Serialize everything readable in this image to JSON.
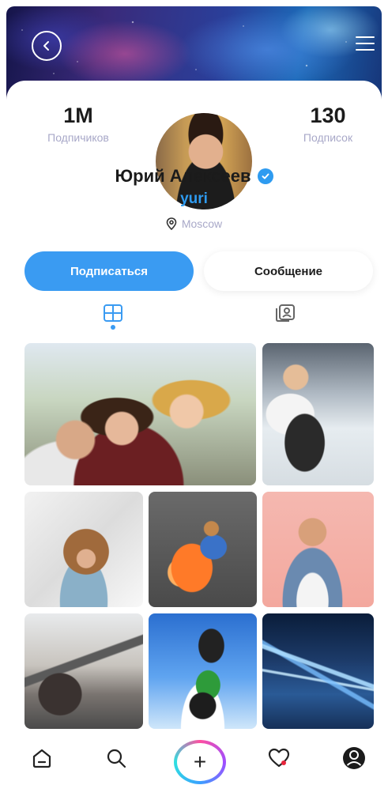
{
  "profile": {
    "name": "Юрий Алексеев",
    "username": "yuri",
    "location": "Moscow",
    "followers_count": "1M",
    "followers_label": "Подпичиков",
    "following_count": "130",
    "following_label": "Подписок"
  },
  "actions": {
    "subscribe_label": "Подписаться",
    "message_label": "Сообщение"
  },
  "tabs": [
    {
      "icon": "grid-icon",
      "active": true
    },
    {
      "icon": "tagged-icon",
      "active": false
    }
  ],
  "photos": [
    "group-selfie",
    "snowboarder",
    "laughing-woman",
    "jumping-man",
    "pointing-man",
    "bike-bridge",
    "motocross",
    "city-lights"
  ],
  "bottom_nav": {
    "items": [
      "home-icon",
      "search-icon",
      "add-icon",
      "heart-icon",
      "profile-icon"
    ],
    "add_glyph": "+"
  },
  "colors": {
    "accent": "#3a9bf2",
    "muted": "#a8a8c8",
    "text": "#1b1b1b"
  }
}
